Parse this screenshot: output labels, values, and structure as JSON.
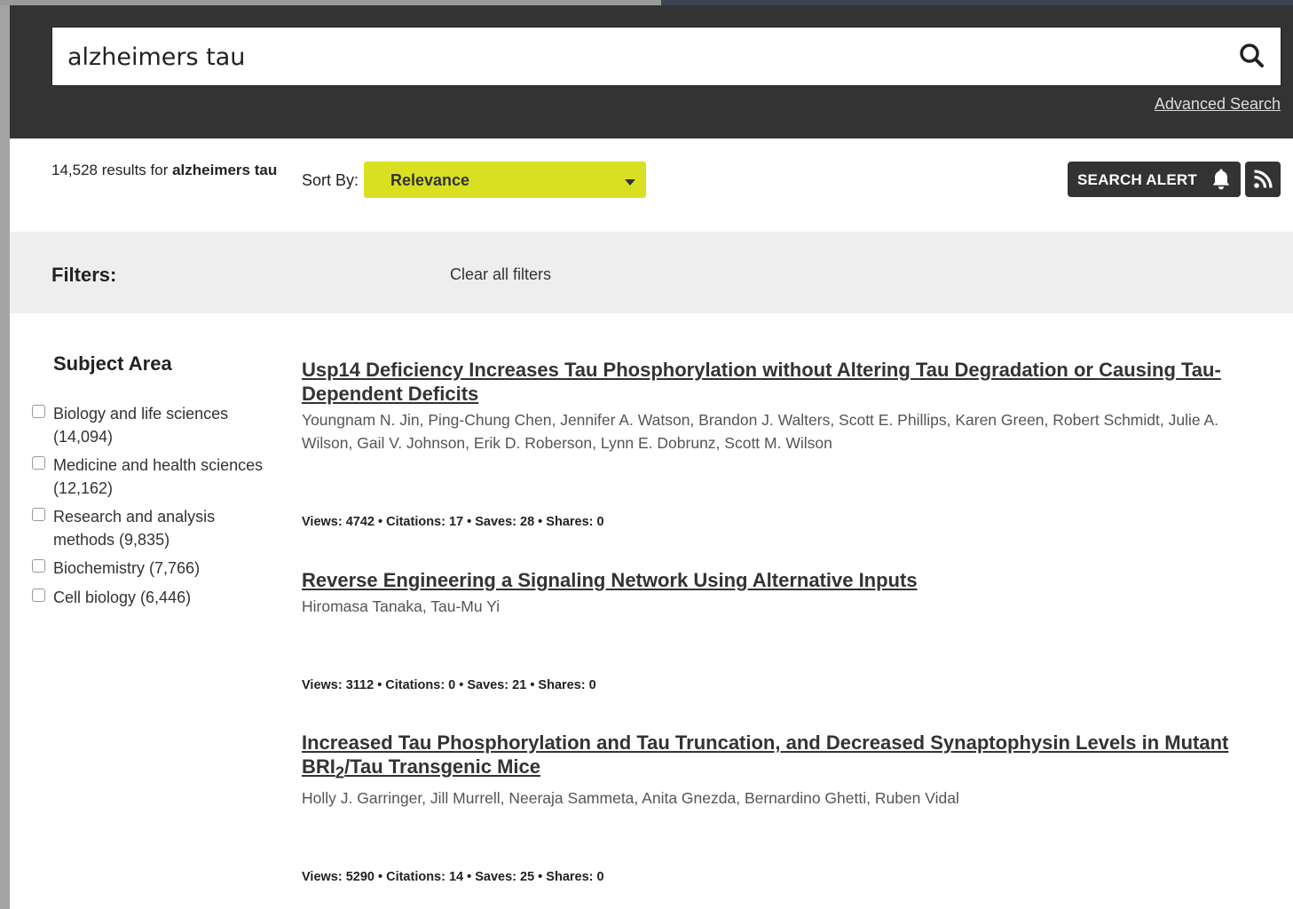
{
  "search": {
    "query": "alzheimers tau",
    "advanced_label": "Advanced Search"
  },
  "results_summary": {
    "count": "14,528",
    "count_suffix": " results for ",
    "query_bold": "alzheimers tau"
  },
  "sort": {
    "label": "Sort By:",
    "selected": "Relevance"
  },
  "actions": {
    "search_alert_label": "SEARCH ALERT"
  },
  "filters": {
    "label": "Filters:",
    "clear_label": "Clear all filters"
  },
  "sidebar": {
    "title": "Subject Area",
    "facets": [
      {
        "label": "Biology and life sciences (14,094)"
      },
      {
        "label": "Medicine and health sciences (12,162)"
      },
      {
        "label": "Research and analysis methods (9,835)"
      },
      {
        "label": "Biochemistry (7,766)"
      },
      {
        "label": "Cell biology (6,446)"
      }
    ]
  },
  "results": [
    {
      "title": "Usp14 Deficiency Increases Tau Phosphorylation without Altering Tau Degradation or Causing Tau-Dependent Deficits",
      "authors": "Youngnam N. Jin, Ping-Chung Chen, Jennifer A. Watson, Brandon J. Walters, Scott E. Phillips, Karen Green, Robert Schmidt, Julie A. Wilson, Gail V. Johnson, Erik D. Roberson, Lynn E. Dobrunz, Scott M. Wilson",
      "stats": "Views: 4742 • Citations: 17 • Saves: 28 • Shares: 0"
    },
    {
      "title": "Reverse Engineering a Signaling Network Using Alternative Inputs",
      "authors": "Hiromasa Tanaka, Tau-Mu Yi",
      "stats": "Views: 3112 • Citations: 0 • Saves: 21 • Shares: 0"
    },
    {
      "title_pre": "Increased Tau Phosphorylation and Tau Truncation, and Decreased Synaptophysin Levels in Mutant BRI",
      "title_sub": "2",
      "title_post": "/Tau Transgenic Mice",
      "authors": "Holly J. Garringer, Jill Murrell, Neeraja Sammeta, Anita Gnezda, Bernardino Ghetti, Ruben Vidal",
      "stats": "Views: 5290 • Citations: 14 • Saves: 25 • Shares: 0"
    }
  ],
  "icons": {
    "search": "search-icon",
    "bell": "bell-icon",
    "rss": "rss-icon",
    "dropdown": "chevron-down-icon"
  },
  "colors": {
    "header_bg": "#333333",
    "sort_accent": "#d9e021",
    "filters_bg": "#eeeeee"
  }
}
